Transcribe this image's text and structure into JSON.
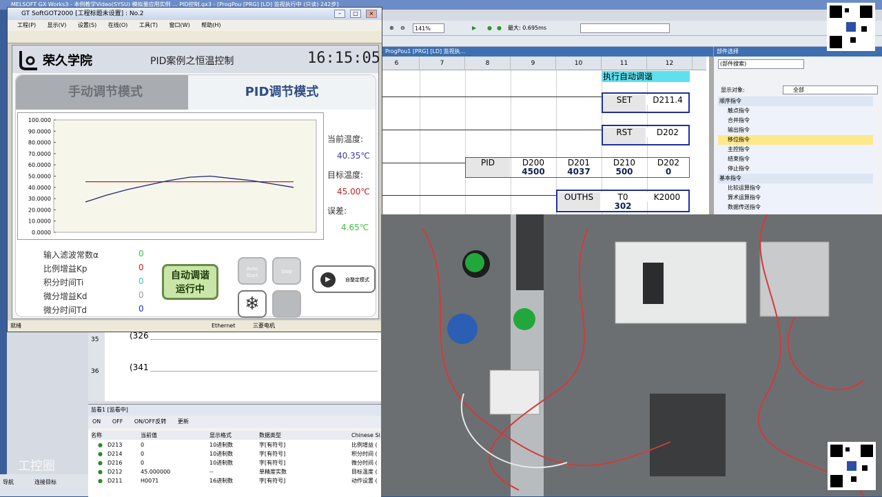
{
  "gx": {
    "title": "MELSOFT GX Works3 - 本例教学Video(SYSU) 模拟量应用实例 ... PID控制.gx3 - [ProgPou [PRG] [LD] 监视执行中 (只读) 242步]",
    "zoom": "141%",
    "max_label": "最大: 0.695ms",
    "ladder_tab": "ProgPou1 [PRG] [LD] 监视执...",
    "columns": [
      "6",
      "7",
      "8",
      "9",
      "10",
      "11",
      "12"
    ],
    "rows": {
      "auto_tune": "执行自动调谐",
      "set_op": "SET",
      "set_arg": "D211.4",
      "rst_op": "RST",
      "rst_arg": "D202",
      "pid_op": "PID",
      "pid_args": [
        {
          "name": "D200",
          "val": "4500"
        },
        {
          "name": "D201",
          "val": "4037"
        },
        {
          "name": "D210",
          "val": "500"
        },
        {
          "name": "D202",
          "val": "0"
        }
      ],
      "ouths_op": "OUTHS",
      "ouths_args": [
        {
          "name": "T0",
          "val": "302"
        },
        {
          "name": "K2000",
          "val": ""
        }
      ]
    },
    "parts_title": "部件选择",
    "parts_search": "(部件搜索)",
    "parts_filter_label": "显示对象:",
    "parts_filter_value": "全部",
    "parts_items": [
      {
        "label": "顺序指令",
        "level": 0,
        "selected": false
      },
      {
        "label": "触点指令",
        "level": 1,
        "selected": false
      },
      {
        "label": "合并指令",
        "level": 1,
        "selected": false
      },
      {
        "label": "输出指令",
        "level": 1,
        "selected": false
      },
      {
        "label": "移位指令",
        "level": 1,
        "selected": true
      },
      {
        "label": "主控指令",
        "level": 1,
        "selected": false
      },
      {
        "label": "结束指令",
        "level": 1,
        "selected": false
      },
      {
        "label": "停止指令",
        "level": 1,
        "selected": false
      },
      {
        "label": "基本指令",
        "level": 0,
        "selected": false
      },
      {
        "label": "比较运算指令",
        "level": 1,
        "selected": false
      },
      {
        "label": "算术运算指令",
        "level": 1,
        "selected": false
      },
      {
        "label": "数据传送指令",
        "level": 1,
        "selected": false
      }
    ]
  },
  "got": {
    "title": "GT SoftGOT2000 [工程标题未设置] : No.2",
    "menu": [
      "工程(P)",
      "显示(V)",
      "设置(S)",
      "在线(O)",
      "工具(T)",
      "窗口(W)",
      "帮助(H)"
    ],
    "logo_text": "荣久学院",
    "screen_title": "PID案例之恒温控制",
    "time": "16:15:05",
    "tab_manual": "手动调节模式",
    "tab_pid": "PID调节模式",
    "current_temp_label": "当前温度:",
    "current_temp": "40.35℃",
    "target_temp_label": "目标温度:",
    "target_temp": "45.00℃",
    "error_label": "误差:",
    "error": "4.65℃",
    "params": [
      {
        "label": "输入滤波常数α",
        "value": "0",
        "color": "#30c040"
      },
      {
        "label": "比例增益Kp",
        "value": "0",
        "color": "#d02020"
      },
      {
        "label": "积分时间Ti",
        "value": "0",
        "color": "#40c0c0"
      },
      {
        "label": "微分增益Kd",
        "value": "0",
        "color": "#999999"
      },
      {
        "label": "微分时间Td",
        "value": "0",
        "color": "#2030c0"
      }
    ],
    "run_button": "自动调谐\n运行中",
    "auto_start": "Auto\nStart",
    "stop": "Stop",
    "self_mode": "自整定模式",
    "status_ready": "就绪",
    "status_ethernet": "Ethernet",
    "status_maker": "三菱电机"
  },
  "chart_data": {
    "type": "line",
    "ylim": [
      0,
      100
    ],
    "y_ticks": [
      "100.000",
      "90.0000",
      "80.0000",
      "70.0000",
      "60.0000",
      "50.0000",
      "40.0000",
      "30.0000",
      "20.0000",
      "10.0000",
      "0.0000"
    ],
    "series": [
      {
        "name": "",
        "color": "#c02020",
        "x": [
          0,
          1,
          2,
          3,
          4,
          5,
          6,
          7,
          8,
          9,
          10
        ],
        "values": [
          45,
          45,
          45,
          45,
          45,
          45,
          45,
          45,
          45,
          45,
          45
        ]
      },
      {
        "name": "",
        "color": "#202080",
        "x": [
          0,
          1,
          2,
          3,
          4,
          5,
          6,
          7,
          8,
          9,
          10
        ],
        "values": [
          27,
          33,
          38,
          42,
          46,
          49,
          50,
          48,
          46,
          43,
          40
        ]
      }
    ]
  },
  "lower": {
    "row35": "35",
    "row35_val": "(326",
    "row36": "36",
    "row36_val": "(341"
  },
  "watch": {
    "title": "监看1 [监看中]",
    "tools": [
      "ON",
      "OFF",
      "ON/OFF反转",
      "更新"
    ],
    "headers": [
      "名称",
      "当前值",
      "显示格式",
      "数据类型",
      "Chinese Si"
    ],
    "rows": [
      [
        "D213",
        "0",
        "10进制数",
        "字[有符号]",
        "比例增益 ("
      ],
      [
        "D214",
        "0",
        "10进制数",
        "字[有符号]",
        "积分时间 ("
      ],
      [
        "D216",
        "0",
        "10进制数",
        "字[有符号]",
        "微分时间 ("
      ],
      [
        "D212",
        "45.000000",
        "--",
        "单精度实数",
        "目标温度 ("
      ],
      [
        "D211",
        "H0071",
        "16进制数",
        "字[有符号]",
        "动作设置 ("
      ]
    ]
  },
  "nav": {
    "nav": "导航",
    "connect": "连接目标"
  },
  "watermark": "工控圈"
}
